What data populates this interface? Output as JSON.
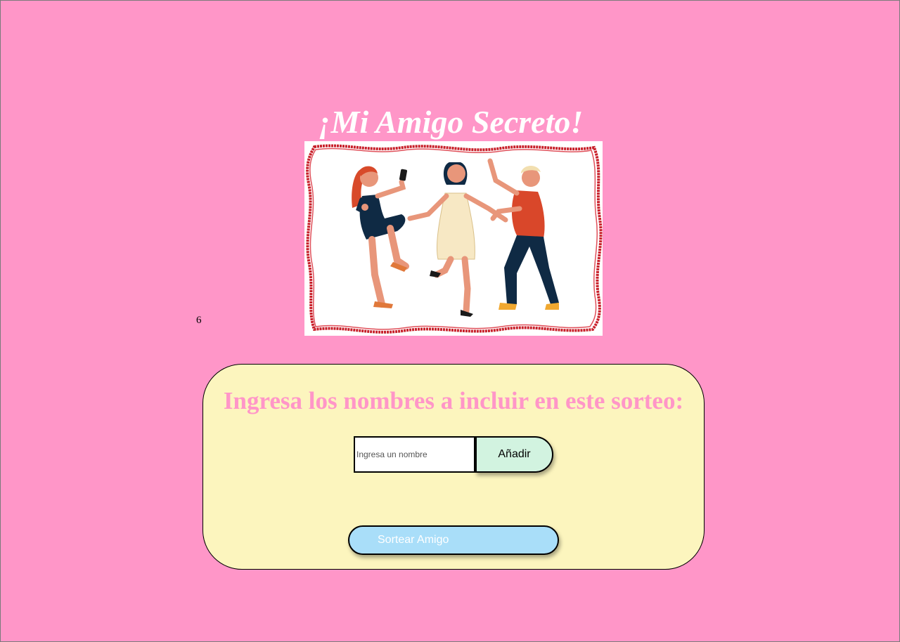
{
  "header": {
    "title": "¡Mi Amigo Secreto!"
  },
  "hero_image": {
    "description_icon": "dancing-friends-illustration",
    "frame_color": "#c8202a"
  },
  "counter": {
    "value": "6"
  },
  "card": {
    "heading": "Ingresa los nombres a incluir en este sorteo:",
    "input": {
      "placeholder": "Ingresa un nombre",
      "value": ""
    },
    "add_label": "Añadir",
    "draw_label": "Sortear Amigo"
  },
  "colors": {
    "background": "#ff96c8",
    "card": "#fcf5be",
    "heading": "#ff96c8",
    "add_button": "#d2f3e0",
    "draw_button": "#a9def9"
  }
}
